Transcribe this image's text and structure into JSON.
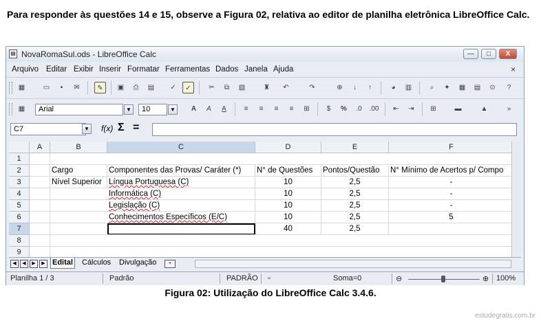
{
  "intro": "Para responder às questões 14 e 15, observe a Figura 02, relativa ao editor de planilha eletrônica LibreOffice Calc.",
  "window": {
    "title": "NovaRomaSul.ods - LibreOffice Calc",
    "buttons": {
      "minimize": "—",
      "maximize": "□",
      "close": "X"
    }
  },
  "menu": [
    "Arquivo",
    "Editar",
    "Exibir",
    "Inserir",
    "Formatar",
    "Ferramentas",
    "Dados",
    "Janela",
    "Ajuda"
  ],
  "menu_close": "×",
  "font": {
    "name": "Arial",
    "size": "10"
  },
  "namebox": "C7",
  "formula_icons": {
    "fx": "f(x)",
    "sum": "Σ",
    "equals": "="
  },
  "columns": [
    "",
    "A",
    "B",
    "C",
    "D",
    "E",
    "F"
  ],
  "rows": [
    {
      "n": "1",
      "B": "",
      "C": "",
      "D": "",
      "E": "",
      "F": ""
    },
    {
      "n": "2",
      "B": "Cargo",
      "C": "Componentes das Provas/ Caráter (*)",
      "D": "N° de Questões",
      "E": "Pontos/Questão",
      "F": "N° Mínimo de Acertos p/ Compo"
    },
    {
      "n": "3",
      "B": "Nível Superior",
      "C": "Língua Portuguesa (C)",
      "D": "10",
      "E": "2,5",
      "F": "-"
    },
    {
      "n": "4",
      "B": "",
      "C": "Informática (C)",
      "D": "10",
      "E": "2,5",
      "F": "-"
    },
    {
      "n": "5",
      "B": "",
      "C": "Legislação (C)",
      "D": "10",
      "E": "2,5",
      "F": "-"
    },
    {
      "n": "6",
      "B": "",
      "C": "Conhecimentos Específicos (E/C)",
      "D": "10",
      "E": "2,5",
      "F": "5"
    },
    {
      "n": "7",
      "B": "",
      "C": "",
      "D": "40",
      "E": "2,5",
      "F": ""
    },
    {
      "n": "8",
      "B": "",
      "C": "",
      "D": "",
      "E": "",
      "F": ""
    },
    {
      "n": "9",
      "B": "",
      "C": "",
      "D": "",
      "E": "",
      "F": ""
    }
  ],
  "sheets": [
    "Edital",
    "Cálculos",
    "Divulgação"
  ],
  "status": {
    "sheet": "Planilha 1 / 3",
    "style": "Padrão",
    "mode": "PADRÃO",
    "sum": "Soma=0",
    "zoom": "100%"
  },
  "caption": "Figura 02: Utilização do LibreOffice Calc 3.4.6.",
  "watermark": "estudegratis.com.br"
}
